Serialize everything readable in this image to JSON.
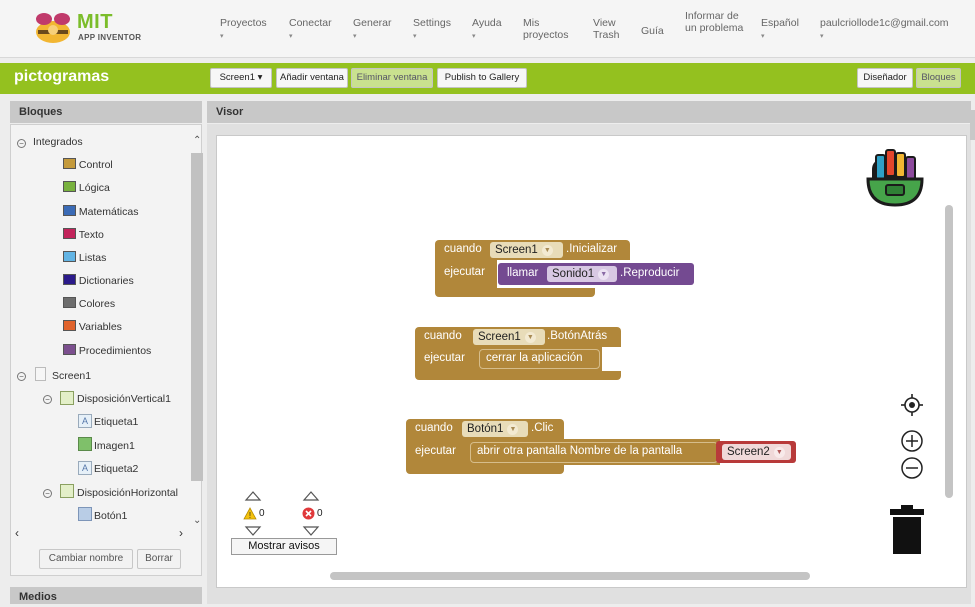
{
  "brand": {
    "name": "MIT",
    "subtitle": "APP INVENTOR"
  },
  "nav": [
    {
      "label": "Proyectos",
      "caret": "▾"
    },
    {
      "label": "Conectar",
      "caret": "▾"
    },
    {
      "label": "Generar",
      "caret": "▾"
    },
    {
      "label": "Settings",
      "caret": "▾"
    },
    {
      "label": "Ayuda",
      "caret": "▾"
    },
    {
      "label": "Mis proyectos"
    },
    {
      "label": "View Trash"
    },
    {
      "label": "Guía"
    },
    {
      "label": "Informar de un problema"
    },
    {
      "label": "Español",
      "caret": "▾"
    },
    {
      "label": "paulcriollode1c@gmail.com",
      "caret": "▾"
    }
  ],
  "project": {
    "name": "pictogramas",
    "screen_select": "Screen1 ▾",
    "add_screen": "Añadir ventana",
    "remove_screen": "Eliminar ventana",
    "publish": "Publish to Gallery",
    "designer": "Diseñador",
    "blocks": "Bloques"
  },
  "blocks_panel": {
    "title": "Bloques",
    "builtin": "Integrados",
    "categories": [
      {
        "label": "Control",
        "color": "#c49a3c"
      },
      {
        "label": "Lógica",
        "color": "#78b13e"
      },
      {
        "label": "Matemáticas",
        "color": "#3b6bb6"
      },
      {
        "label": "Texto",
        "color": "#c2245b"
      },
      {
        "label": "Listas",
        "color": "#62b4e4"
      },
      {
        "label": "Dictionaries",
        "color": "#2b1a8a"
      },
      {
        "label": "Colores",
        "color": "#6d6d6d"
      },
      {
        "label": "Variables",
        "color": "#e0632c"
      },
      {
        "label": "Procedimientos",
        "color": "#7b4f8e"
      }
    ],
    "components": [
      {
        "label": "Screen1",
        "level": 0
      },
      {
        "label": "DisposiciónVertical1",
        "level": 1
      },
      {
        "label": "Etiqueta1",
        "level": 2
      },
      {
        "label": "Imagen1",
        "level": 2
      },
      {
        "label": "Etiqueta2",
        "level": 2
      },
      {
        "label": "DisposiciónHorizontal",
        "level": 1
      },
      {
        "label": "Botón1",
        "level": 2
      }
    ],
    "rename": "Cambiar nombre",
    "delete": "Borrar"
  },
  "media_panel": {
    "title": "Medios"
  },
  "workspace": {
    "title": "Visor",
    "block1": {
      "when": "cuando",
      "component": "Screen1",
      "event": ".Inicializar",
      "do": "ejecutar",
      "call": "llamar",
      "callee": "Sonido1",
      "method": ".Reproducir"
    },
    "block2": {
      "when": "cuando",
      "component": "Screen1",
      "event": ".BotónAtrás",
      "do": "ejecutar",
      "action": "cerrar la aplicación"
    },
    "block3": {
      "when": "cuando",
      "component": "Botón1",
      "event": ".Clic",
      "do": "ejecutar",
      "action": "abrir otra pantalla  Nombre de la pantalla",
      "value": "Screen2"
    },
    "warnings_count": "0",
    "errors_count": "0",
    "show_warnings": "Mostrar avisos"
  }
}
